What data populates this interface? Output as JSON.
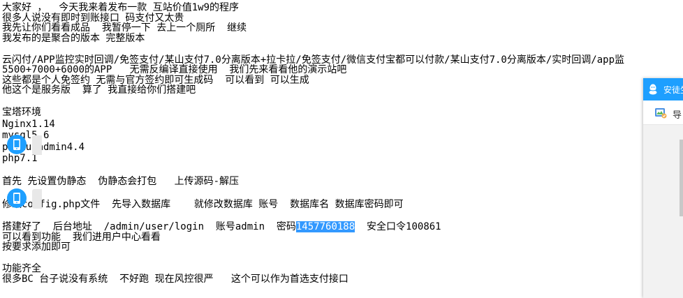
{
  "document": {
    "lines": [
      {
        "text": "大家好 ，  今天我来着发布一款 互站价值1w9的程序",
        "style": "tight"
      },
      {
        "text": "很多人说没有即时到账接口 码支付又太贵",
        "style": "tight"
      },
      {
        "text": "我先让你们看看成品  我暂停一下 去上一个厕所  继续",
        "style": "tight"
      },
      {
        "text": "我发布的是聚合的版本 完整版本",
        "style": "tight"
      },
      {
        "text": "",
        "style": "blank"
      },
      {
        "text": "云闪付/APP监控实时回调/免签支付/某山支付7.0分离版本+拉卡拉/免签支付/微信支付宝都可以付款/某山支付7.0分离版本/实时回调/app监",
        "style": "tight"
      },
      {
        "text": "5500+7000+6000的APP   无需反编译直接使用  我们先来看看他的演示站吧",
        "style": "tight"
      },
      {
        "text": "这些都是个人免签约 无需与官方签约即可生成码  可以看到 可以生成",
        "style": "tight"
      },
      {
        "text": "他这个是服务版  算了 我直接给你们搭建吧",
        "style": "tight"
      },
      {
        "text": "",
        "style": "blank"
      },
      {
        "text": "宝塔环境",
        "style": "normal"
      },
      {
        "text": "Nginx1.14",
        "style": "normal"
      },
      {
        "text": "mysql5.6",
        "style": "normal"
      },
      {
        "text": "phpmuyadmin4.4",
        "style": "normal"
      },
      {
        "text": "php7.1",
        "style": "normal"
      },
      {
        "text": "",
        "style": "blank"
      },
      {
        "text": "首先 先设置伪静态  伪静态会打包   上传源码-解压",
        "style": "normal"
      },
      {
        "text": "",
        "style": "blank"
      },
      {
        "text": "修改config.php文件  先导入数据库    就修改数据库 账号  数据库名 数据库密码即可",
        "style": "normal"
      },
      {
        "text": "",
        "style": "blank"
      }
    ],
    "login_line": {
      "before": "搭建好了  后台地址  /admin/user/login  账号admin  密码",
      "selected": "1457760188",
      "after": "  安全口令100861"
    },
    "lines_after": [
      {
        "text": "可以看到功能  我们进用户中心看看",
        "style": "tight"
      },
      {
        "text": "按要求添加即可",
        "style": "tight"
      },
      {
        "text": "",
        "style": "blank"
      },
      {
        "text": "功能齐全",
        "style": "tight"
      },
      {
        "text": "很多BC 台子说没有系统  不好跑 现在风控很严   这个可以作为首选支付接口",
        "style": "tight"
      }
    ]
  },
  "side_panel": {
    "header_label": "安徒生",
    "nav_label": "导",
    "header_color": "#1e9fff"
  },
  "selection_color": "#3399ff"
}
